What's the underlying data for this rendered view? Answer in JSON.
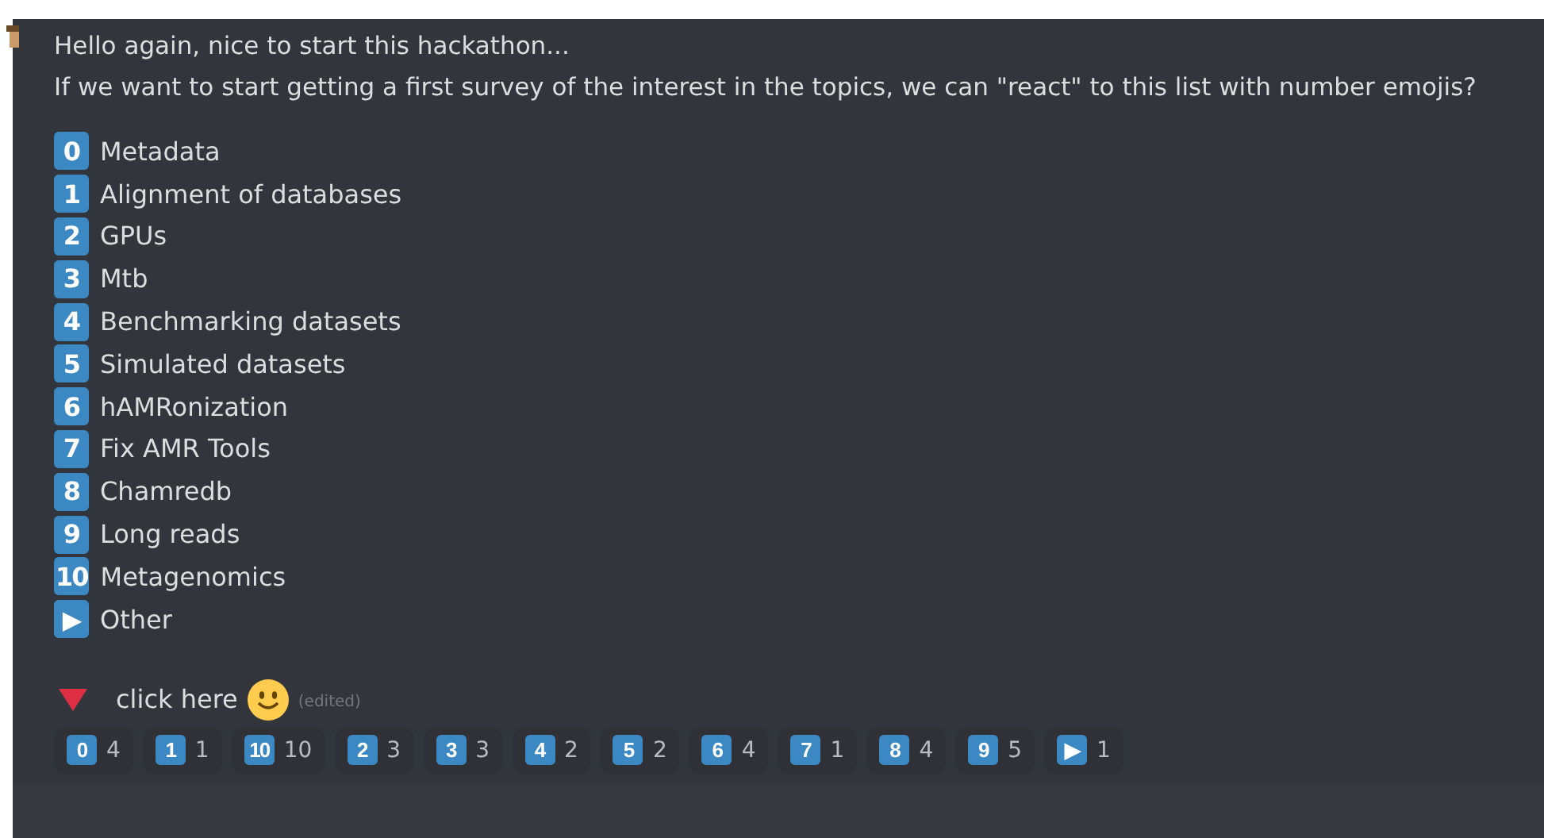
{
  "message": {
    "lines": [
      "Hello again, nice to start this hackathon...",
      "If we want to start getting a first survey of the interest in the topics, we can \"react\" to this list with number emojis?"
    ],
    "topics": [
      {
        "key": "0",
        "label": "Metadata"
      },
      {
        "key": "1",
        "label": "Alignment of databases"
      },
      {
        "key": "2",
        "label": "GPUs"
      },
      {
        "key": "3",
        "label": "Mtb"
      },
      {
        "key": "4",
        "label": "Benchmarking datasets"
      },
      {
        "key": "5",
        "label": "Simulated datasets"
      },
      {
        "key": "6",
        "label": "hAMRonization"
      },
      {
        "key": "7",
        "label": "Fix AMR Tools"
      },
      {
        "key": "8",
        "label": "Chamredb"
      },
      {
        "key": "9",
        "label": "Long reads"
      },
      {
        "key": "10",
        "label": "Metagenomics"
      },
      {
        "key": "▶",
        "label": "Other"
      }
    ],
    "footer": {
      "text": "click here",
      "edited": "(edited)"
    },
    "reactions": [
      {
        "key": "0",
        "count": "4"
      },
      {
        "key": "1",
        "count": "1"
      },
      {
        "key": "10",
        "count": "10"
      },
      {
        "key": "2",
        "count": "3"
      },
      {
        "key": "3",
        "count": "3"
      },
      {
        "key": "4",
        "count": "2"
      },
      {
        "key": "5",
        "count": "2"
      },
      {
        "key": "6",
        "count": "4"
      },
      {
        "key": "7",
        "count": "1"
      },
      {
        "key": "8",
        "count": "4"
      },
      {
        "key": "9",
        "count": "5"
      },
      {
        "key": "▶",
        "count": "1"
      }
    ]
  }
}
